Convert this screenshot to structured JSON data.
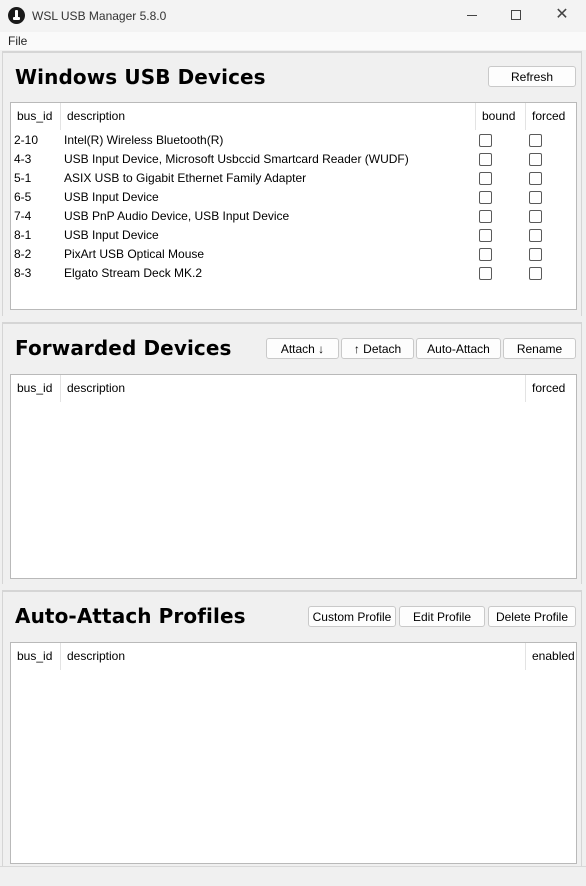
{
  "window": {
    "title": "WSL USB Manager 5.8.0",
    "minimize_glyph": "",
    "close_glyph": "✕"
  },
  "menu": {
    "file": "File"
  },
  "windows_usb": {
    "title": "Windows USB Devices",
    "refresh_label": "Refresh",
    "columns": {
      "bus_id": "bus_id",
      "description": "description",
      "bound": "bound",
      "forced": "forced"
    },
    "rows": [
      {
        "bus_id": "2-10",
        "description": "Intel(R) Wireless Bluetooth(R)",
        "bound": false,
        "forced": false
      },
      {
        "bus_id": "4-3",
        "description": "USB Input Device, Microsoft Usbccid Smartcard Reader (WUDF)",
        "bound": false,
        "forced": false
      },
      {
        "bus_id": "5-1",
        "description": "ASIX USB to Gigabit Ethernet Family Adapter",
        "bound": false,
        "forced": false
      },
      {
        "bus_id": "6-5",
        "description": "USB Input Device",
        "bound": false,
        "forced": false
      },
      {
        "bus_id": "7-4",
        "description": "USB PnP Audio Device, USB Input Device",
        "bound": false,
        "forced": false
      },
      {
        "bus_id": "8-1",
        "description": "USB Input Device",
        "bound": false,
        "forced": false
      },
      {
        "bus_id": "8-2",
        "description": "PixArt USB Optical Mouse",
        "bound": false,
        "forced": false
      },
      {
        "bus_id": "8-3",
        "description": "Elgato Stream Deck MK.2",
        "bound": false,
        "forced": false
      }
    ]
  },
  "forwarded": {
    "title": "Forwarded Devices",
    "attach_label": "Attach ↓",
    "detach_label": "↑ Detach",
    "auto_attach_label": "Auto-Attach",
    "rename_label": "Rename",
    "columns": {
      "bus_id": "bus_id",
      "description": "description",
      "forced": "forced"
    }
  },
  "profiles": {
    "title": "Auto-Attach Profiles",
    "custom_label": "Custom Profile",
    "edit_label": "Edit Profile",
    "delete_label": "Delete Profile",
    "columns": {
      "bus_id": "bus_id",
      "description": "description",
      "enabled": "enabled"
    }
  }
}
